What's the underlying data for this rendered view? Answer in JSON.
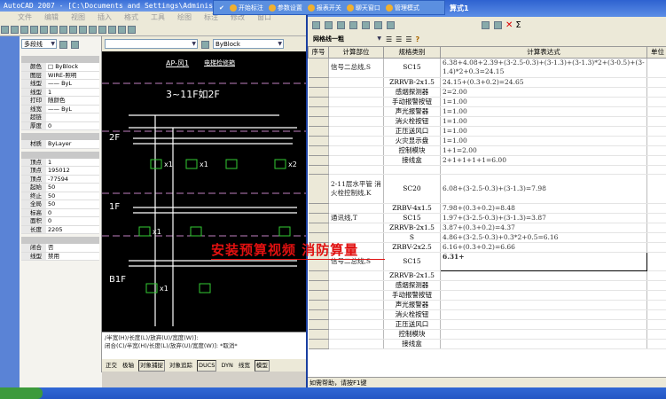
{
  "cad": {
    "title": "AutoCAD 2007 - [C:\\Documents and Settings\\Administ",
    "menus": [
      "文件",
      "编辑",
      "视图",
      "插入",
      "格式",
      "工具",
      "绘图",
      "标注",
      "修改",
      "窗口"
    ],
    "entity_combo": "多段线",
    "layer_combo": "",
    "color_combo": "ByBlock",
    "props": {
      "general": [
        [
          "颜色",
          "□ ByBlock"
        ],
        [
          "图层",
          "WIRE-照明"
        ],
        [
          "线型",
          "—— ByL"
        ],
        [
          "线型",
          "1"
        ],
        [
          "打印",
          "随颜色"
        ],
        [
          "线宽",
          "—— ByL"
        ],
        [
          "超链接",
          ""
        ],
        [
          "厚度",
          "0"
        ]
      ],
      "three_d": [
        [
          "材质",
          "ByLayer"
        ]
      ],
      "geometry": [
        [
          "顶点",
          "1"
        ],
        [
          "顶点",
          "195012"
        ],
        [
          "顶点",
          "-77594"
        ],
        [
          "起始",
          "50"
        ],
        [
          "终止",
          "50"
        ],
        [
          "全局",
          "50"
        ],
        [
          "标高",
          "0"
        ],
        [
          "面积",
          "0"
        ],
        [
          "长度",
          "2205"
        ]
      ],
      "misc": [
        [
          "闭合",
          "否"
        ],
        [
          "线型",
          "禁用"
        ]
      ]
    },
    "drawing": {
      "header1": "AP-风1",
      "header2": "电梯检修箱",
      "floor_range": "3~11F如2F",
      "floors": [
        "2F",
        "1F",
        "B1F"
      ],
      "qty1": "x1",
      "qty2": "x2"
    },
    "command_lines": [
      "/半宽(H)/长度(L)/放弃(U)/宽度(W)]:",
      "闭合(C)/半宽(H)/长度(L)/放弃(U)/宽度(W)]: *取消*"
    ],
    "status_toggles": [
      "正交",
      "极轴",
      "对象捕捉",
      "对象追踪",
      "DUCS",
      "DYN",
      "线宽",
      "模型"
    ]
  },
  "floatbar": [
    "开始标注",
    "参数设置",
    "报表开关",
    "聊天窗口",
    "管理模式"
  ],
  "calc": {
    "title": "算式1",
    "line_combo": "网格线一粗",
    "headers": [
      "序号",
      "计算部位",
      "规格类别",
      "计算表达式",
      "单位"
    ],
    "rows": [
      {
        "part": "信号二总线,S",
        "spec": "SC15",
        "expr": "6.38+4.08+2.39+(3-2.5-0.3)+(3-1.3)+(3-1.3)*2+(3-0.5)+(3-1.4)*2+0.3=24.15",
        "h": 2
      },
      {
        "part": "",
        "spec": "ZRRVB-2x1.5",
        "expr": "24.15+(0.3+0.2)=24.65"
      },
      {
        "part": "",
        "spec": "感烟探测器",
        "expr": "2=2.00"
      },
      {
        "part": "",
        "spec": "手动报警按钮",
        "expr": "1=1.00"
      },
      {
        "part": "",
        "spec": "声光报警器",
        "expr": "1=1.00"
      },
      {
        "part": "",
        "spec": "消火栓按钮",
        "expr": "1=1.00"
      },
      {
        "part": "",
        "spec": "正压送风口",
        "expr": "1=1.00"
      },
      {
        "part": "",
        "spec": "火灾显示盘",
        "expr": "1=1.00"
      },
      {
        "part": "",
        "spec": "控制模块",
        "expr": "1+1=2.00"
      },
      {
        "part": "",
        "spec": "接线盒",
        "expr": "2+1+1+1+1=6.00"
      },
      {
        "part": "",
        "spec": "",
        "expr": ""
      },
      {
        "part": "2-11层水平管 消火栓控制线,K",
        "spec": "SC20",
        "expr": "6.08+(3-2.5-0.3)+(3-1.3)=7.98",
        "h": 3
      },
      {
        "part": "",
        "spec": "ZRBV-4x1.5",
        "expr": "7.98+(0.3+0.2)=8.48"
      },
      {
        "part": "通讯线,T",
        "spec": "SC15",
        "expr": "1.97+(3-2.5-0.3)+(3-1.3)=3.87"
      },
      {
        "part": "",
        "spec": "ZRRVB-2x1.5",
        "expr": "3.87+(0.3+0.2)=4.37"
      },
      {
        "part": "",
        "spec": "S",
        "expr": "4.86+(3-2.5-0.3)+0.3*2+0.5=6.16"
      },
      {
        "part": "",
        "spec": "ZRBV-2x2.5",
        "expr": "6.16+(0.3+0.2)=6.66"
      },
      {
        "part": "信号二总线,S",
        "spec": "SC15",
        "expr": "6.31+",
        "h": 2,
        "editing": true
      },
      {
        "part": "",
        "spec": "ZRRVB-2x1.5",
        "expr": ""
      },
      {
        "part": "",
        "spec": "感烟探测器",
        "expr": ""
      },
      {
        "part": "",
        "spec": "手动报警按钮",
        "expr": ""
      },
      {
        "part": "",
        "spec": "声光报警器",
        "expr": ""
      },
      {
        "part": "",
        "spec": "消火栓按钮",
        "expr": ""
      },
      {
        "part": "",
        "spec": "正压送风口",
        "expr": ""
      },
      {
        "part": "",
        "spec": "控制模块",
        "expr": ""
      },
      {
        "part": "",
        "spec": "接线盒",
        "expr": ""
      }
    ],
    "status": "如需帮助，请按F1键"
  },
  "overlay": "安装预算视频 消防算量"
}
